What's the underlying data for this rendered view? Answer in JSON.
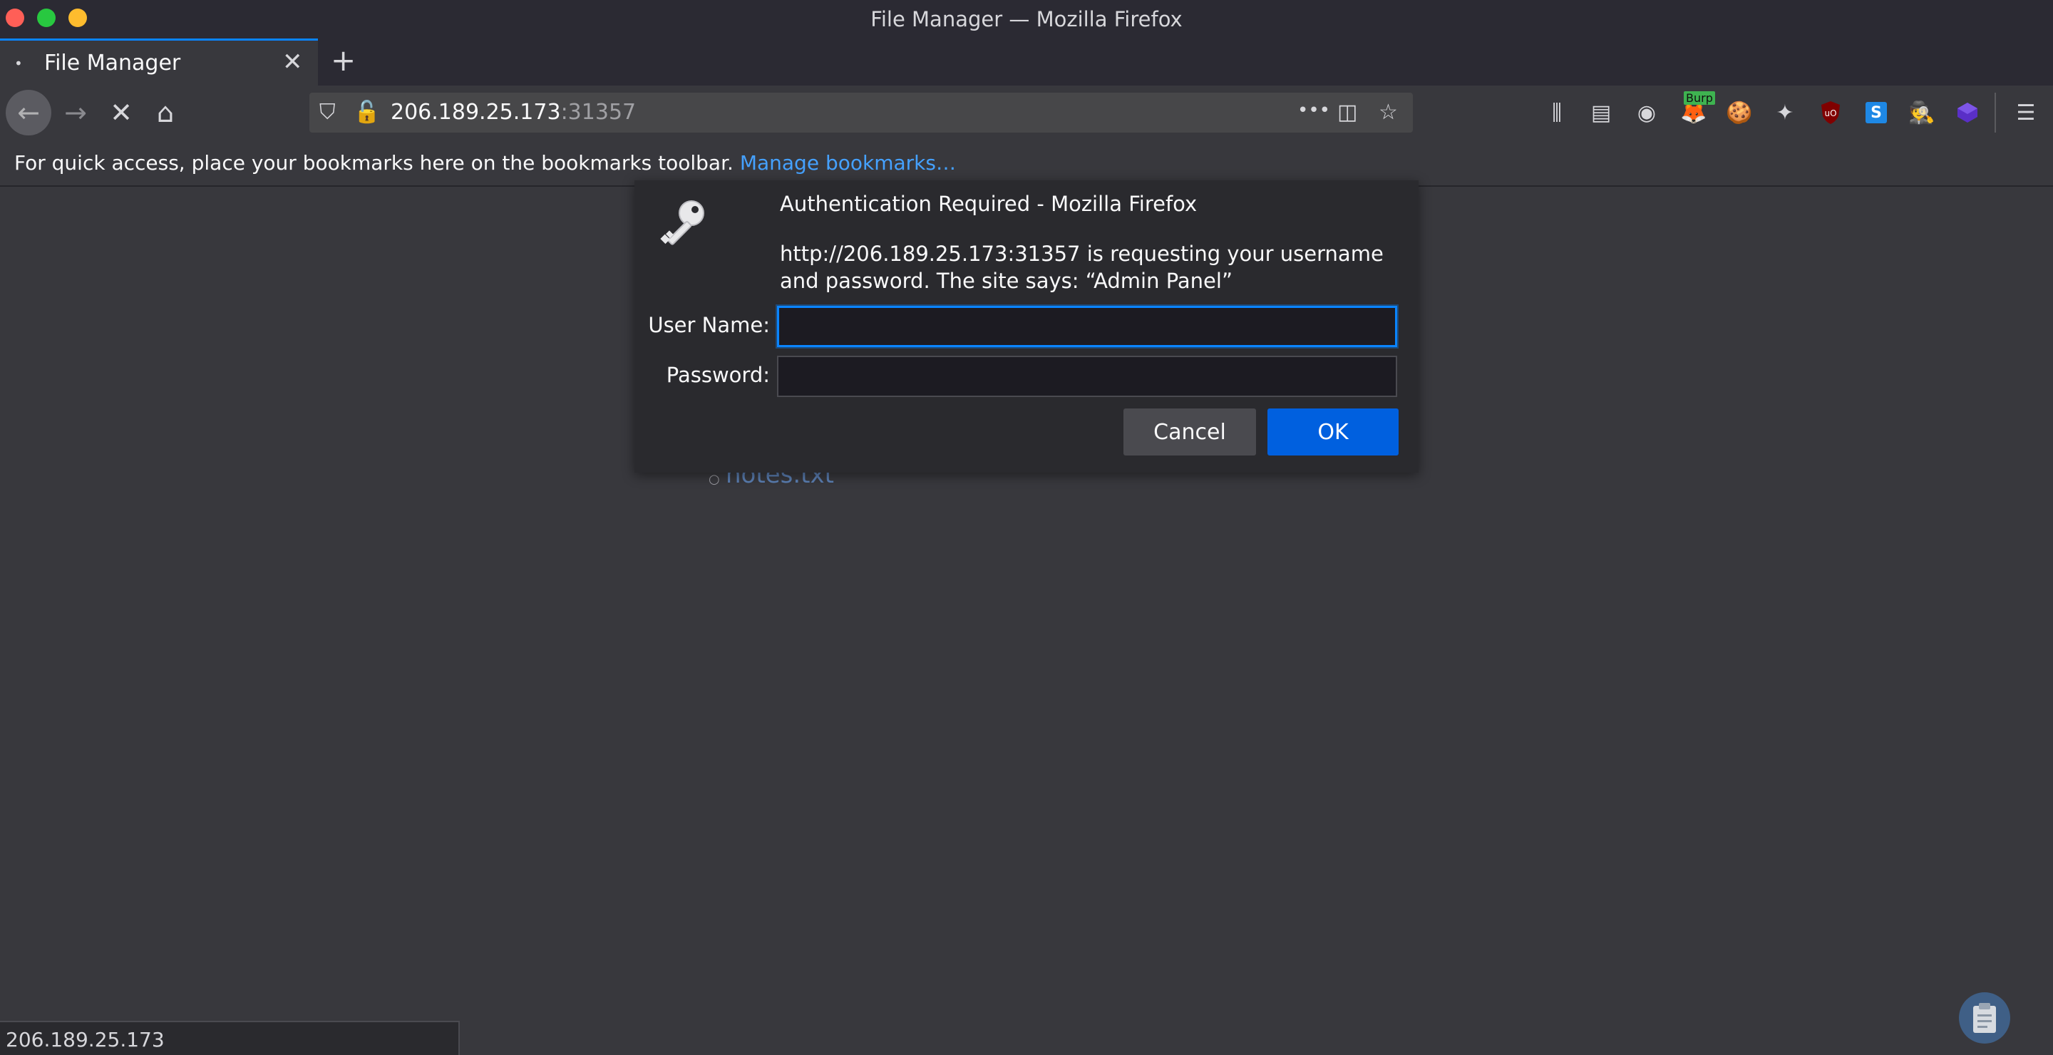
{
  "window": {
    "title": "File Manager — Mozilla Firefox",
    "traffic_lights": {
      "close": "#ff5f57",
      "maximize": "#28c840",
      "minimize": "#febc2e"
    }
  },
  "tab": {
    "title": "File Manager",
    "favicon": "loading-dot-icon",
    "close_glyph": "✕"
  },
  "newtab": {
    "glyph": "+"
  },
  "nav": {
    "back_glyph": "←",
    "forward_glyph": "→",
    "stop_glyph": "✕",
    "home_glyph": "⌂"
  },
  "urlbar": {
    "host": "206.189.25.173",
    "port": ":31357",
    "more_glyph": "•••"
  },
  "toolbar": {
    "burp_badge": "Burp",
    "icons": [
      "library-icon",
      "sidebar-icon",
      "account-icon",
      "foxyproxy-burp-icon",
      "cookie-icon",
      "wappalyzer-icon",
      "ublock-icon",
      "s-extension-icon",
      "spy-extension-icon",
      "cube-extension-icon",
      "menu-icon"
    ]
  },
  "bookmarks": {
    "prompt": "For quick access, place your bookmarks here on the bookmarks toolbar.",
    "link": "Manage bookmarks…"
  },
  "page": {
    "file_link": "notes.txt"
  },
  "dialog": {
    "title": "Authentication Required - Mozilla Firefox",
    "message": "http://206.189.25.173:31357 is requesting your username and password. The site says: “Admin Panel”",
    "username_label": "User Name:",
    "password_label": "Password:",
    "username_value": "",
    "password_value": "",
    "cancel_label": "Cancel",
    "ok_label": "OK"
  },
  "status": {
    "text": "206.189.25.173"
  },
  "colors": {
    "accent": "#0a84ff",
    "ok_button": "#0060df",
    "dialog_bg": "#2a2a2e",
    "page_bg": "#38383d"
  }
}
